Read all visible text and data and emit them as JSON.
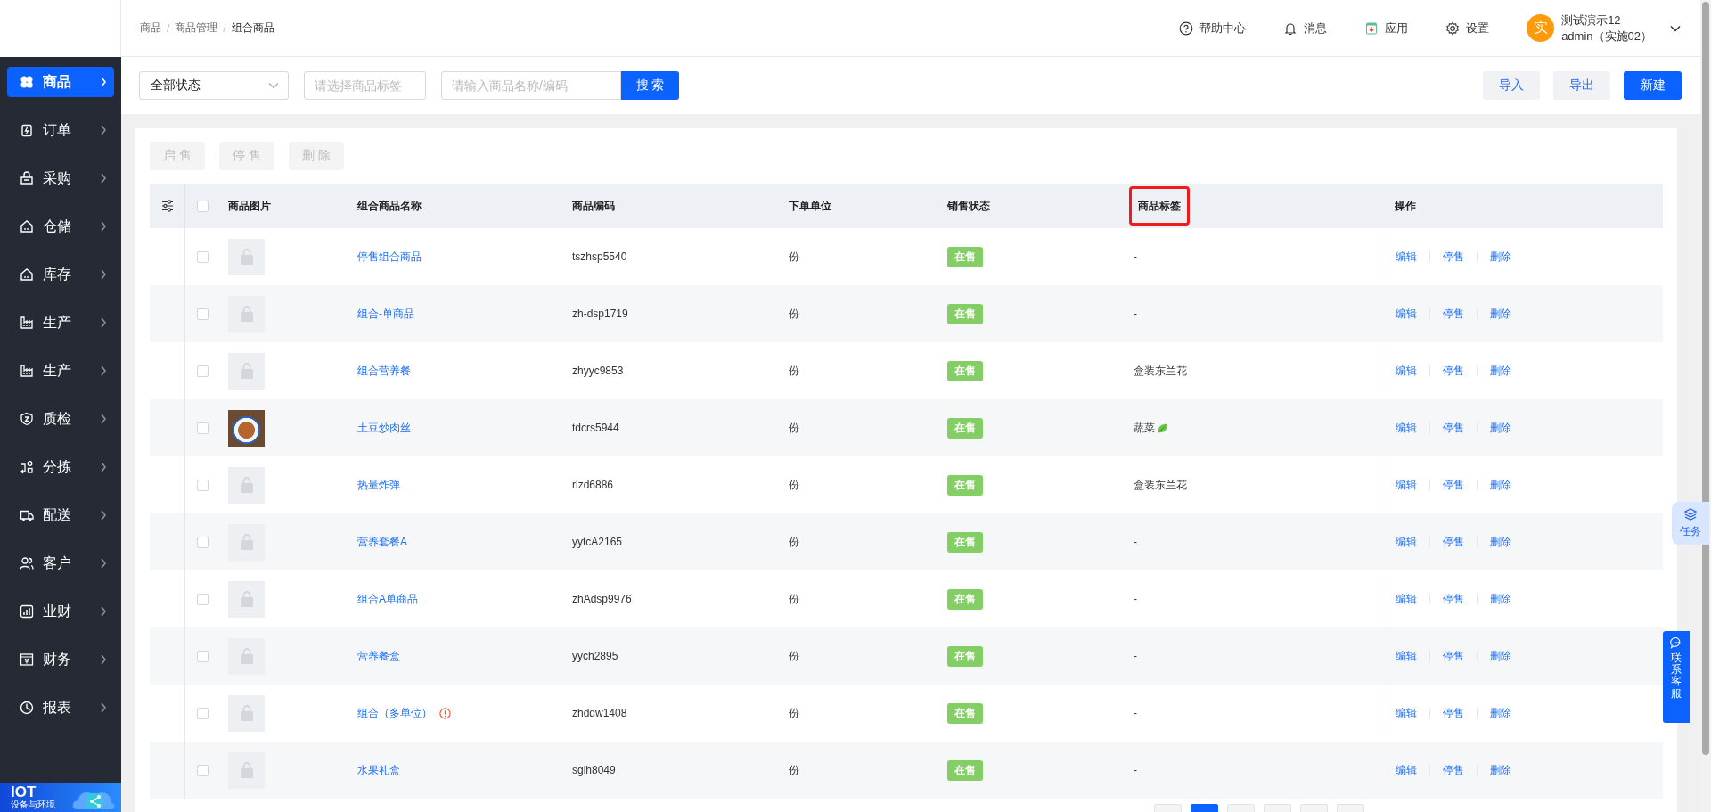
{
  "sidebar": {
    "items": [
      {
        "label": "商品",
        "selected": true
      },
      {
        "label": "订单",
        "selected": false
      },
      {
        "label": "采购",
        "selected": false
      },
      {
        "label": "仓储",
        "selected": false
      },
      {
        "label": "库存",
        "selected": false
      },
      {
        "label": "生产",
        "selected": false
      },
      {
        "label": "生产",
        "selected": false
      },
      {
        "label": "质检",
        "selected": false
      },
      {
        "label": "分拣",
        "selected": false
      },
      {
        "label": "配送",
        "selected": false
      },
      {
        "label": "客户",
        "selected": false
      },
      {
        "label": "业财",
        "selected": false
      },
      {
        "label": "财务",
        "selected": false
      },
      {
        "label": "报表",
        "selected": false
      }
    ],
    "banner": {
      "title": "IOT",
      "subtitle": "设备与环境"
    }
  },
  "breadcrumb": [
    "商品",
    "商品管理",
    "组合商品"
  ],
  "breadcrumb_separator": "/",
  "header": {
    "links": [
      "帮助中心",
      "消息",
      "应用",
      "设置"
    ],
    "user": {
      "avatar": "实",
      "name": "测试演示12",
      "account": "admin（实施02）"
    }
  },
  "filters": {
    "status": "全部状态",
    "tag_placeholder": "请选择商品标签",
    "search_placeholder": "请输入商品名称/编码",
    "search_button": "搜 索"
  },
  "actions": [
    "导入",
    "导出",
    "新建"
  ],
  "bulk_actions": [
    {
      "label": "启 售",
      "disabled": true
    },
    {
      "label": "停 售",
      "disabled": true
    },
    {
      "label": "删 除",
      "disabled": true
    }
  ],
  "table": {
    "all_checked": false,
    "columns": [
      {
        "label": "商品图片",
        "highlighted": false
      },
      {
        "label": "组合商品名称",
        "highlighted": false
      },
      {
        "label": "商品编码",
        "highlighted": false
      },
      {
        "label": "下单单位",
        "highlighted": false
      },
      {
        "label": "销售状态",
        "highlighted": false
      },
      {
        "label": "商品标签",
        "highlighted": true
      },
      {
        "label": "操作",
        "highlighted": false
      }
    ],
    "rows": [
      {
        "checked": false,
        "kind": "placeholder",
        "name": "停售组合商品",
        "warning": false,
        "code": "tszhsp5540",
        "unit": "份",
        "status": "在售",
        "tag": "-",
        "tag_leaf": false,
        "ops": [
          "编辑",
          "停售",
          "删除"
        ]
      },
      {
        "checked": false,
        "kind": "placeholder",
        "name": "组合-单商品",
        "warning": false,
        "code": "zh-dsp1719",
        "unit": "份",
        "status": "在售",
        "tag": "-",
        "tag_leaf": false,
        "ops": [
          "编辑",
          "停售",
          "删除"
        ]
      },
      {
        "checked": false,
        "kind": "placeholder",
        "name": "组合营养餐",
        "warning": false,
        "code": "zhyyc9853",
        "unit": "份",
        "status": "在售",
        "tag": "盒装东兰花",
        "tag_leaf": false,
        "ops": [
          "编辑",
          "停售",
          "删除"
        ]
      },
      {
        "checked": false,
        "kind": "photo",
        "name": "土豆炒肉丝",
        "warning": false,
        "code": "tdcrs5944",
        "unit": "份",
        "status": "在售",
        "tag": "蔬菜",
        "tag_leaf": true,
        "ops": [
          "编辑",
          "停售",
          "删除"
        ]
      },
      {
        "checked": false,
        "kind": "placeholder",
        "name": "热量炸弹",
        "warning": false,
        "code": "rlzd6886",
        "unit": "份",
        "status": "在售",
        "tag": "盒装东兰花",
        "tag_leaf": false,
        "ops": [
          "编辑",
          "停售",
          "删除"
        ]
      },
      {
        "checked": false,
        "kind": "placeholder",
        "name": "营养套餐A",
        "warning": false,
        "code": "yytcA2165",
        "unit": "份",
        "status": "在售",
        "tag": "-",
        "tag_leaf": false,
        "ops": [
          "编辑",
          "停售",
          "删除"
        ]
      },
      {
        "checked": false,
        "kind": "placeholder",
        "name": "组合A单商品",
        "warning": false,
        "code": "zhAdsp9976",
        "unit": "份",
        "status": "在售",
        "tag": "-",
        "tag_leaf": false,
        "ops": [
          "编辑",
          "停售",
          "删除"
        ]
      },
      {
        "checked": false,
        "kind": "placeholder",
        "name": "营养餐盒",
        "warning": false,
        "code": "yych2895",
        "unit": "份",
        "status": "在售",
        "tag": "-",
        "tag_leaf": false,
        "ops": [
          "编辑",
          "停售",
          "删除"
        ]
      },
      {
        "checked": false,
        "kind": "placeholder",
        "name": "组合（多单位）",
        "warning": true,
        "code": "zhddw1408",
        "unit": "份",
        "status": "在售",
        "tag": "-",
        "tag_leaf": false,
        "ops": [
          "编辑",
          "停售",
          "删除"
        ]
      },
      {
        "checked": false,
        "kind": "placeholder",
        "name": "水果礼盒",
        "warning": false,
        "code": "sglh8049",
        "unit": "份",
        "status": "在售",
        "tag": "-",
        "tag_leaf": false,
        "ops": [
          "编辑",
          "停售",
          "删除"
        ]
      }
    ]
  },
  "pagination": [
    {
      "selected": false
    },
    {
      "selected": true
    },
    {
      "selected": false
    },
    {
      "selected": false
    },
    {
      "selected": false
    },
    {
      "selected": false
    }
  ],
  "float_buttons": {
    "task": "任务",
    "service": "联系客服"
  }
}
